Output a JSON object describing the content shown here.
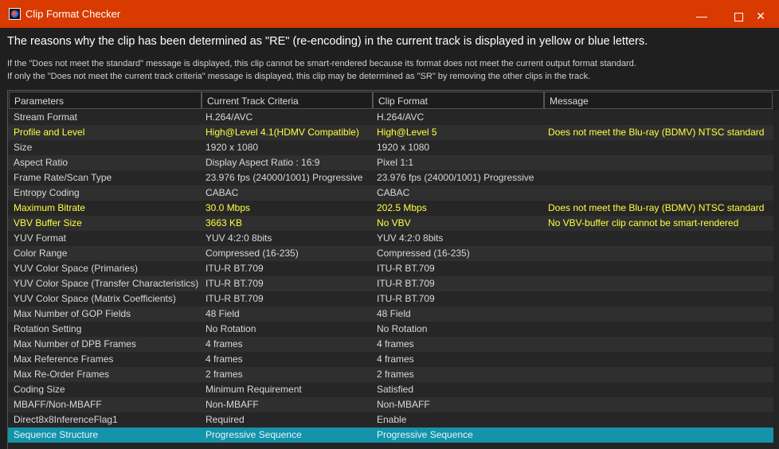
{
  "window": {
    "title": "Clip Format Checker",
    "minimize": "—",
    "close": "✕"
  },
  "headline": "The reasons why the clip has been determined as \"RE\" (re-encoding) in the current track is displayed in yellow or blue letters.",
  "notes": [
    "If the \"Does not meet the standard\" message is displayed, this clip cannot be smart-rendered because its format does not meet the current output format standard.",
    "If only the \"Does not meet the current track criteria\" message is displayed, this clip may be determined as \"SR\" by removing the other clips in the track."
  ],
  "table": {
    "columns": [
      "Parameters",
      "Current Track Criteria",
      "Clip Format",
      "Message"
    ],
    "rows": [
      {
        "param": "Stream Format",
        "criteria": "H.264/AVC",
        "clip": "H.264/AVC",
        "message": "",
        "highlight": ""
      },
      {
        "param": "Profile and Level",
        "criteria": "High@Level 4.1(HDMV Compatible)",
        "clip": "High@Level 5",
        "message": "Does not meet the Blu-ray (BDMV) NTSC standard",
        "highlight": "yellow"
      },
      {
        "param": "Size",
        "criteria": "1920 x 1080",
        "clip": "1920 x 1080",
        "message": "",
        "highlight": ""
      },
      {
        "param": "Aspect Ratio",
        "criteria": "Display Aspect Ratio : 16:9",
        "clip": "Pixel 1:1",
        "message": "",
        "highlight": ""
      },
      {
        "param": "Frame Rate/Scan Type",
        "criteria": "23.976 fps (24000/1001) Progressive",
        "clip": "23.976 fps (24000/1001) Progressive",
        "message": "",
        "highlight": ""
      },
      {
        "param": "Entropy Coding",
        "criteria": "CABAC",
        "clip": "CABAC",
        "message": "",
        "highlight": ""
      },
      {
        "param": "Maximum Bitrate",
        "criteria": "30.0 Mbps",
        "clip": "202.5 Mbps",
        "message": "Does not meet the Blu-ray (BDMV) NTSC standard",
        "highlight": "yellow"
      },
      {
        "param": "VBV Buffer Size",
        "criteria": "3663 KB",
        "clip": "No VBV",
        "message": "No VBV-buffer clip cannot be smart-rendered",
        "highlight": "yellow"
      },
      {
        "param": "YUV Format",
        "criteria": "YUV 4:2:0 8bits",
        "clip": "YUV 4:2:0 8bits",
        "message": "",
        "highlight": ""
      },
      {
        "param": "Color Range",
        "criteria": "Compressed (16-235)",
        "clip": "Compressed (16-235)",
        "message": "",
        "highlight": ""
      },
      {
        "param": "YUV Color Space (Primaries)",
        "criteria": "ITU-R BT.709",
        "clip": "ITU-R BT.709",
        "message": "",
        "highlight": ""
      },
      {
        "param": "YUV Color Space (Transfer Characteristics)",
        "criteria": "ITU-R BT.709",
        "clip": "ITU-R BT.709",
        "message": "",
        "highlight": ""
      },
      {
        "param": "YUV Color Space (Matrix Coefficients)",
        "criteria": "ITU-R BT.709",
        "clip": "ITU-R BT.709",
        "message": "",
        "highlight": ""
      },
      {
        "param": "Max Number of GOP Fields",
        "criteria": "48 Field",
        "clip": "48 Field",
        "message": "",
        "highlight": ""
      },
      {
        "param": "Rotation Setting",
        "criteria": "No Rotation",
        "clip": "No Rotation",
        "message": "",
        "highlight": ""
      },
      {
        "param": "Max Number of DPB Frames",
        "criteria": "4  frames",
        "clip": "4  frames",
        "message": "",
        "highlight": ""
      },
      {
        "param": "Max Reference Frames",
        "criteria": "4  frames",
        "clip": "4  frames",
        "message": "",
        "highlight": ""
      },
      {
        "param": "Max Re-Order Frames",
        "criteria": "2  frames",
        "clip": "2  frames",
        "message": "",
        "highlight": ""
      },
      {
        "param": "Coding Size",
        "criteria": "Minimum Requirement",
        "clip": "Satisfied",
        "message": "",
        "highlight": ""
      },
      {
        "param": "MBAFF/Non-MBAFF",
        "criteria": "Non-MBAFF",
        "clip": "Non-MBAFF",
        "message": "",
        "highlight": ""
      },
      {
        "param": "Direct8x8InferenceFlag1",
        "criteria": "Required",
        "clip": "Enable",
        "message": "",
        "highlight": ""
      },
      {
        "param": "Sequence Structure",
        "criteria": "Progressive Sequence",
        "clip": "Progressive Sequence",
        "message": "",
        "highlight": "selected"
      }
    ]
  },
  "colors": {
    "titlebar": "#d83a00",
    "highlight_text": "#ffff40",
    "selection": "#1493aa"
  }
}
